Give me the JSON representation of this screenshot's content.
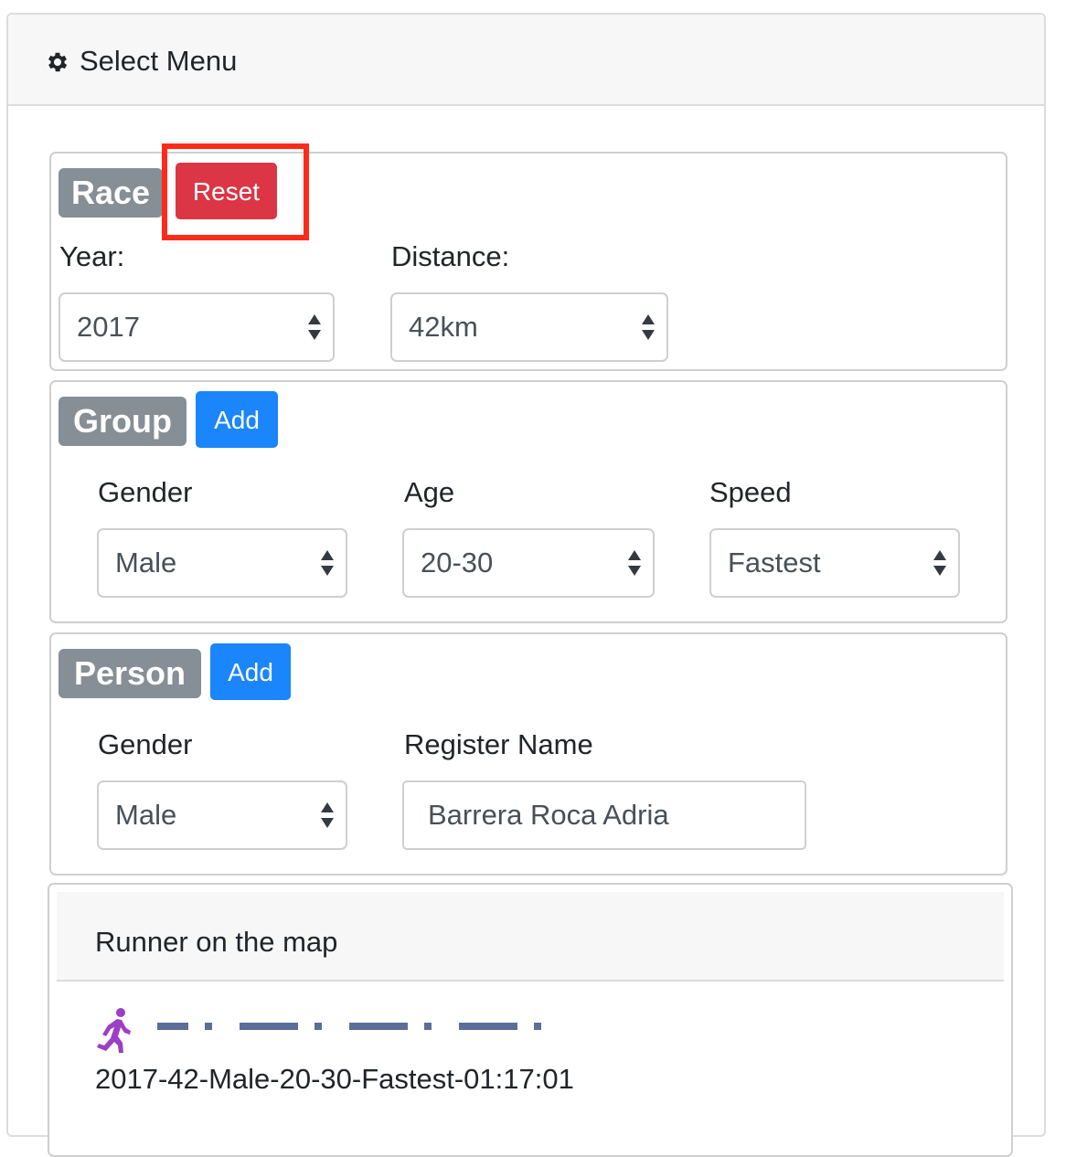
{
  "header": {
    "title": "Select Menu",
    "icon": "gear-icon"
  },
  "race": {
    "badge": "Race",
    "reset_label": "Reset",
    "year_label": "Year:",
    "year_value": "2017",
    "distance_label": "Distance:",
    "distance_value": "42km"
  },
  "group": {
    "badge": "Group",
    "add_label": "Add",
    "gender_label": "Gender",
    "gender_value": "Male",
    "age_label": "Age",
    "age_value": "20-30",
    "speed_label": "Speed",
    "speed_value": "Fastest"
  },
  "person": {
    "badge": "Person",
    "add_label": "Add",
    "gender_label": "Gender",
    "gender_value": "Male",
    "name_label": "Register Name",
    "name_value": "Barrera Roca Adria"
  },
  "map": {
    "title": "Runner on the map",
    "runner_icon": "running-person-icon",
    "route_color": "#5b6e9a",
    "entry": "2017-42-Male-20-30-Fastest-01:17:01"
  },
  "colors": {
    "danger": "#dc3545",
    "primary": "#1b85fb",
    "badge": "#868e96",
    "highlight": "#ff2a1a",
    "runner": "#9b3fc4"
  }
}
